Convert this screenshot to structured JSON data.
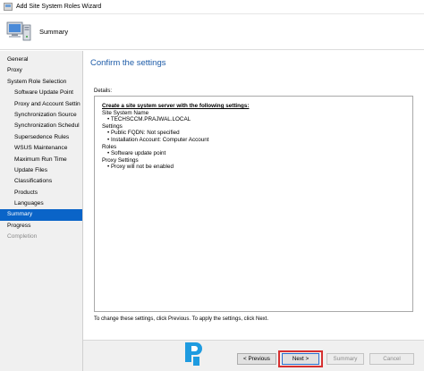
{
  "window": {
    "title": "Add Site System Roles Wizard"
  },
  "header": {
    "label": "Summary"
  },
  "sidebar": {
    "items": [
      {
        "label": "General",
        "level": 0,
        "state": "normal"
      },
      {
        "label": "Proxy",
        "level": 0,
        "state": "normal"
      },
      {
        "label": "System Role Selection",
        "level": 0,
        "state": "normal"
      },
      {
        "label": "Software Update Point",
        "level": 1,
        "state": "normal"
      },
      {
        "label": "Proxy and Account Settin",
        "level": 1,
        "state": "normal"
      },
      {
        "label": "Synchronization Source",
        "level": 1,
        "state": "normal"
      },
      {
        "label": "Synchronization Schedul",
        "level": 1,
        "state": "normal"
      },
      {
        "label": "Supersedence Rules",
        "level": 1,
        "state": "normal"
      },
      {
        "label": "WSUS Maintenance",
        "level": 1,
        "state": "normal"
      },
      {
        "label": "Maximum Run Time",
        "level": 1,
        "state": "normal"
      },
      {
        "label": "Update Files",
        "level": 1,
        "state": "normal"
      },
      {
        "label": "Classifications",
        "level": 1,
        "state": "normal"
      },
      {
        "label": "Products",
        "level": 1,
        "state": "normal"
      },
      {
        "label": "Languages",
        "level": 1,
        "state": "normal"
      },
      {
        "label": "Summary",
        "level": 0,
        "state": "active"
      },
      {
        "label": "Progress",
        "level": 0,
        "state": "normal"
      },
      {
        "label": "Completion",
        "level": 0,
        "state": "disabled"
      }
    ]
  },
  "main": {
    "title": "Confirm the settings",
    "details_label": "Details:",
    "details": {
      "intro": "Create a site system server with the following settings:",
      "lines": [
        {
          "text": "Site System Name",
          "indent": 0
        },
        {
          "text": "• TECHSCCM.PRAJWAL.LOCAL",
          "indent": 1
        },
        {
          "text": "Settings",
          "indent": 0
        },
        {
          "text": "• Public FQDN: Not specified",
          "indent": 1
        },
        {
          "text": "• Installation Account: Computer Account",
          "indent": 1
        },
        {
          "text": "Roles",
          "indent": 0
        },
        {
          "text": "• Software update point",
          "indent": 1
        },
        {
          "text": "Proxy Settings",
          "indent": 0
        },
        {
          "text": "• Proxy will not be enabled",
          "indent": 1
        }
      ]
    },
    "footer_text": "To change these settings, click Previous. To apply the settings, click Next."
  },
  "buttons": {
    "previous": "< Previous",
    "next": "Next >",
    "summary": "Summary",
    "cancel": "Cancel"
  },
  "colors": {
    "accent": "#0a64c8",
    "title_blue": "#1e5ca8",
    "highlight_red": "#d63030"
  }
}
